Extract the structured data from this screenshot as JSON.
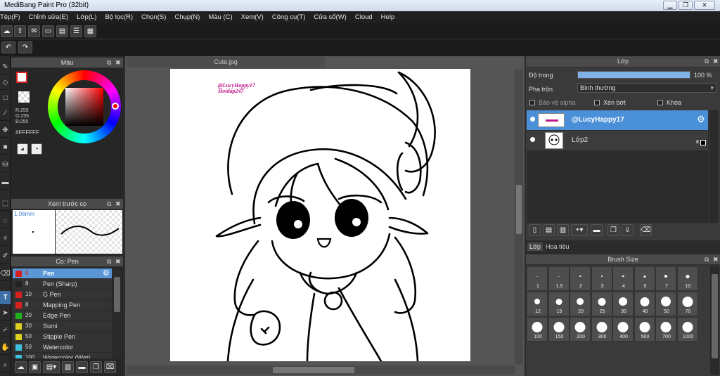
{
  "app": {
    "title": "MediBang Paint Pro (32bit)"
  },
  "menu": [
    "Tệp(F)",
    "Chỉnh sửa(E)",
    "Lớp(L)",
    "Bộ lọc(R)",
    "Chọn(S)",
    "Chụp(N)",
    "Màu (C)",
    "Xem(V)",
    "Công cụ(T)",
    "Cửa sổ(W)",
    "Cloud",
    "Help"
  ],
  "color_panel": {
    "title": "Màu",
    "r": "R:255",
    "g": "G:255",
    "b": "B:255",
    "hex": "#FFFFFF"
  },
  "preview_panel": {
    "title": "Xem trước cọ",
    "size": "1.06mm"
  },
  "brush_panel": {
    "title": "Cọ: Pen",
    "brushes": [
      {
        "size": "8",
        "name": "Pen",
        "color": "#d82020",
        "selected": true
      },
      {
        "size": "8",
        "name": "Pen (Sharp)",
        "color": "#222222",
        "selected": false
      },
      {
        "size": "10",
        "name": "G Pen",
        "color": "#d82020",
        "selected": false
      },
      {
        "size": "8",
        "name": "Mapping Pen",
        "color": "#d82020",
        "selected": false
      },
      {
        "size": "20",
        "name": "Edge Pen",
        "color": "#20b020",
        "selected": false
      },
      {
        "size": "30",
        "name": "Sumi",
        "color": "#e0d020",
        "selected": false
      },
      {
        "size": "50",
        "name": "Stipple Pen",
        "color": "#e0d020",
        "selected": false
      },
      {
        "size": "50",
        "name": "Watercolor",
        "color": "#40c0e0",
        "selected": false
      },
      {
        "size": "100",
        "name": "Watercolor (Wet)",
        "color": "#40c0e0",
        "selected": false
      }
    ]
  },
  "document": {
    "tab": "Cute.jpg",
    "watermark1": "@LucyHappy17",
    "watermark2": "Hoidap247"
  },
  "layer_panel": {
    "title": "Lớp",
    "opacity_label": "Độ trong",
    "opacity_value": "100 %",
    "opacity_fraction": 1.0,
    "blend_label": "Pha trộn",
    "blend_value": "Bình thường",
    "protect_alpha": "Bảo vệ alpha",
    "clip": "Xén bớt",
    "lock": "Khóa",
    "layers": [
      {
        "name": "@LucyHappy17",
        "selected": true
      },
      {
        "name": "Lớp2",
        "selected": false,
        "badge": "8"
      }
    ],
    "tabs": [
      "Lớp",
      "Hoa tiêu"
    ]
  },
  "brush_size_panel": {
    "title": "Brush Size",
    "sizes": [
      [
        "1",
        "1.5",
        "2",
        "3",
        "4",
        "5",
        "7",
        "10"
      ],
      [
        "12",
        "15",
        "20",
        "25",
        "30",
        "40",
        "50",
        "70"
      ],
      [
        "100",
        "150",
        "200",
        "300",
        "400",
        "500",
        "700",
        "1000"
      ]
    ]
  }
}
